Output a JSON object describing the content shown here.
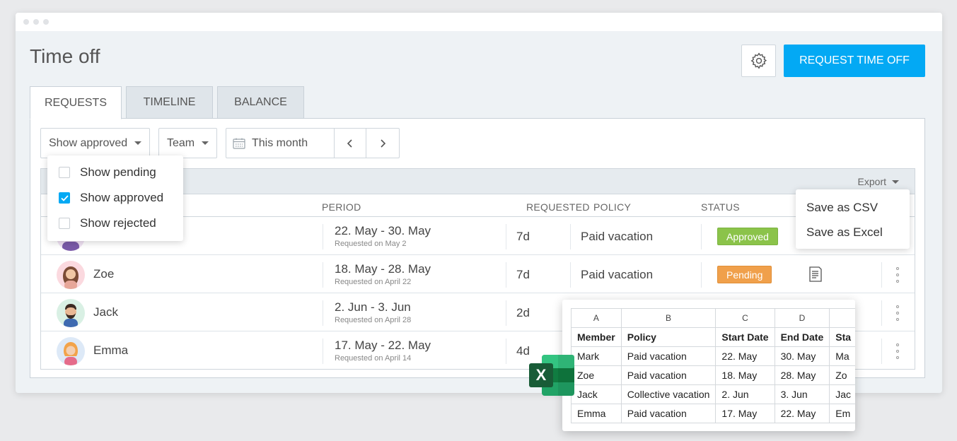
{
  "page": {
    "title": "Time off",
    "request_button": "REQUEST TIME OFF"
  },
  "tabs": [
    {
      "label": "REQUESTS",
      "active": true
    },
    {
      "label": "TIMELINE",
      "active": false
    },
    {
      "label": "BALANCE",
      "active": false
    }
  ],
  "filters": {
    "status_filter": "Show approved",
    "team_filter": "Team",
    "date_range": "This month"
  },
  "status_dropdown": {
    "items": [
      {
        "label": "Show pending",
        "checked": false
      },
      {
        "label": "Show approved",
        "checked": true
      },
      {
        "label": "Show rejected",
        "checked": false
      }
    ]
  },
  "table": {
    "export_label": "Export",
    "columns": {
      "period": "PERIOD",
      "requested": "REQUESTED",
      "policy": "POLICY",
      "status": "STATUS"
    },
    "rows": [
      {
        "name": "",
        "period": "22. May - 30. May",
        "requested_on": "Requested on May 2",
        "days": "7d",
        "policy": "Paid vacation",
        "status": "Approved"
      },
      {
        "name": "Zoe",
        "period": "18. May - 28. May",
        "requested_on": "Requested on April 22",
        "days": "7d",
        "policy": "Paid vacation",
        "status": "Pending"
      },
      {
        "name": "Jack",
        "period": "2. Jun - 3. Jun",
        "requested_on": "Requested on April 28",
        "days": "2d",
        "policy": "",
        "status": ""
      },
      {
        "name": "Emma",
        "period": "17. May - 22. May",
        "requested_on": "Requested on April 14",
        "days": "4d",
        "policy": "",
        "status": ""
      }
    ]
  },
  "export_menu": {
    "items": [
      "Save as CSV",
      "Save as Excel"
    ]
  },
  "spreadsheet": {
    "column_letters": [
      "A",
      "B",
      "C",
      "D",
      ""
    ],
    "header": [
      "Member",
      "Policy",
      "Start Date",
      "End Date",
      "Sta"
    ],
    "rows": [
      [
        "Mark",
        "Paid vacation",
        "22. May",
        "30. May",
        "Ma"
      ],
      [
        "Zoe",
        "Paid vacation",
        "18. May",
        "28. May",
        "Zo"
      ],
      [
        "Jack",
        "Collective vacation",
        "2. Jun",
        "3. Jun",
        "Jac"
      ],
      [
        "Emma",
        "Paid vacation",
        "17. May",
        "22. May",
        "Em"
      ]
    ]
  },
  "excel_logo_letter": "X",
  "colors": {
    "accent": "#03a9f4",
    "approved": "#8bc34a",
    "pending": "#f0a04b",
    "excel_green": "#1f7a45"
  }
}
